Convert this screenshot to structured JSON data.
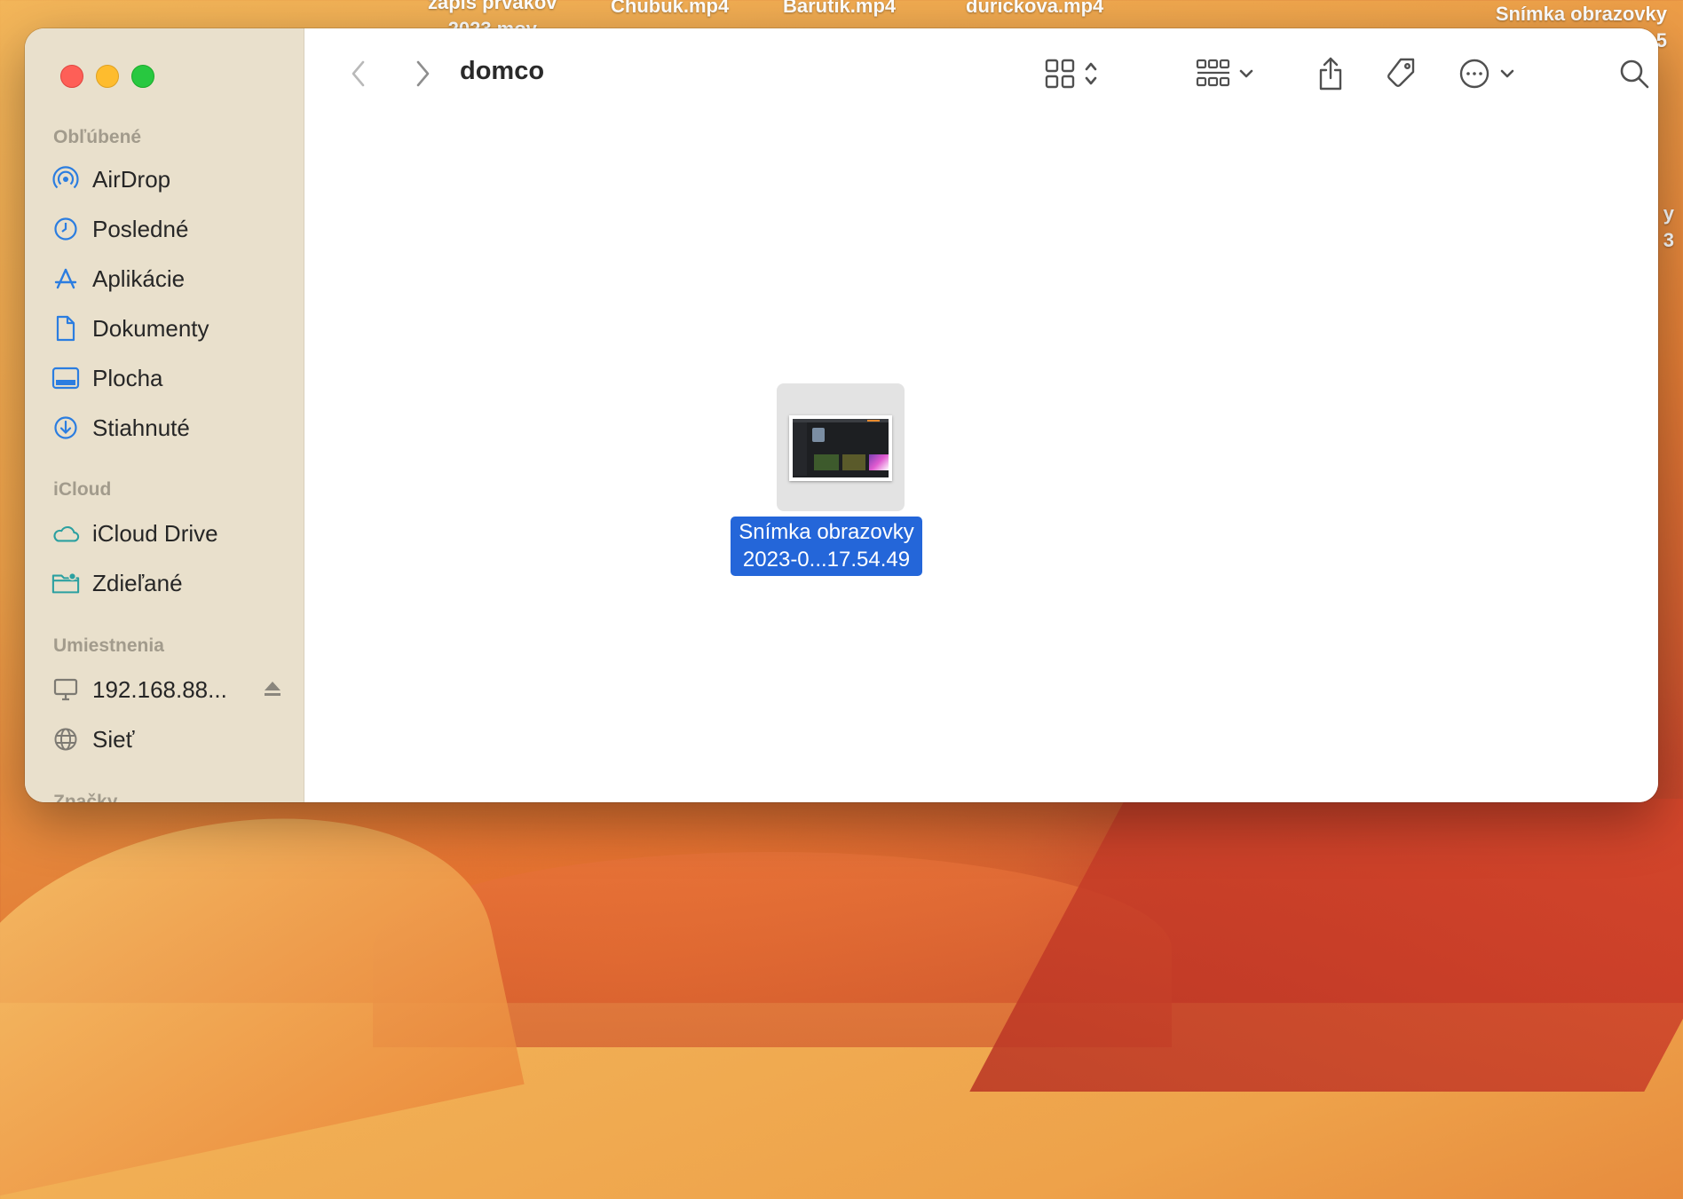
{
  "desktop": {
    "labels": [
      {
        "line1": "zápis prvákov",
        "line2": "2023.mov"
      },
      {
        "line1": "Chubuk.mp4"
      },
      {
        "line1": "Barutik.mp4"
      },
      {
        "line1": "durickova.mp4"
      },
      {
        "line1": "Snímka obrazovky",
        "line2": "5"
      }
    ],
    "partial_right": {
      "line1": "y",
      "line2": "3"
    }
  },
  "window": {
    "title": "domco",
    "colors": {
      "close": "#fe5f57",
      "minimize": "#febc2e",
      "maximize": "#28c840",
      "accent": "#2466d9"
    }
  },
  "toolbar": {
    "back_icon": "chevron-left-icon",
    "forward_icon": "chevron-right-icon",
    "view_icon": "icon-grid-icon",
    "group_icon": "group-icon",
    "share_icon": "share-icon",
    "tag_icon": "tag-icon",
    "more_icon": "ellipsis-circle-icon",
    "search_icon": "search-icon"
  },
  "sidebar": {
    "favorites_header": "Obľúbené",
    "favorites": [
      {
        "label": "AirDrop",
        "icon": "airdrop-icon"
      },
      {
        "label": "Posledné",
        "icon": "clock-icon"
      },
      {
        "label": "Aplikácie",
        "icon": "applications-icon"
      },
      {
        "label": "Dokumenty",
        "icon": "document-icon"
      },
      {
        "label": "Plocha",
        "icon": "desktop-icon"
      },
      {
        "label": "Stiahnuté",
        "icon": "download-icon"
      }
    ],
    "icloud_header": "iCloud",
    "icloud": [
      {
        "label": "iCloud Drive",
        "icon": "cloud-icon"
      },
      {
        "label": "Zdieľané",
        "icon": "shared-folder-icon"
      }
    ],
    "locations_header": "Umiestnenia",
    "locations": [
      {
        "label": "192.168.88...",
        "icon": "computer-icon",
        "eject_icon": "eject-icon"
      },
      {
        "label": "Sieť",
        "icon": "globe-icon"
      }
    ],
    "tags_header_partial": "Značky"
  },
  "files": [
    {
      "name_line1": "Snímka obrazovky",
      "name_line2": "2023-0...17.54.49",
      "selected": true
    }
  ]
}
